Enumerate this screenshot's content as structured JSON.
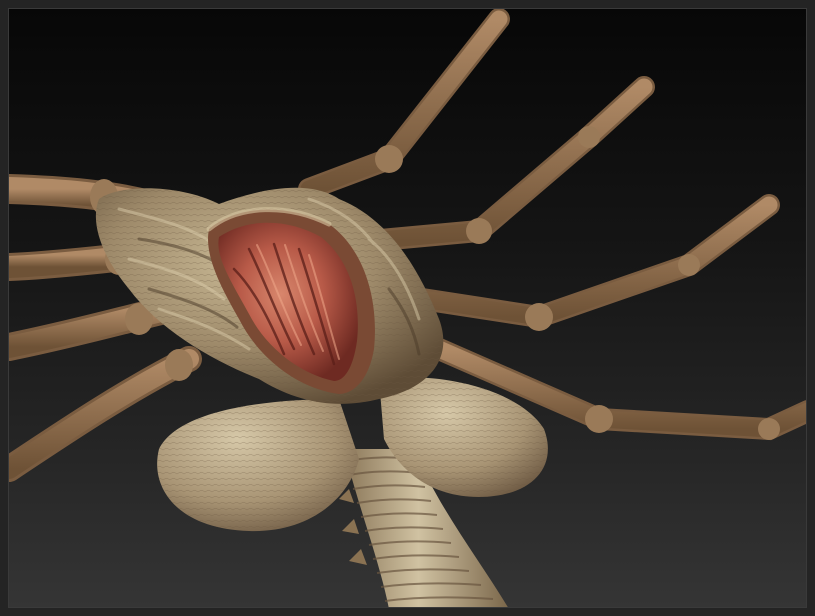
{
  "scene": {
    "subject": "facehugger-sculpt",
    "colors": {
      "background_top": "#070707",
      "background_bottom": "#353535",
      "skin": "#9e8a6a",
      "skin_light": "#c8b894",
      "skin_dark": "#5e4c36",
      "leg": "#8a6a4c",
      "leg_light": "#b08a66",
      "flesh": "#b85a48",
      "flesh_dark": "#6e2a22"
    }
  }
}
